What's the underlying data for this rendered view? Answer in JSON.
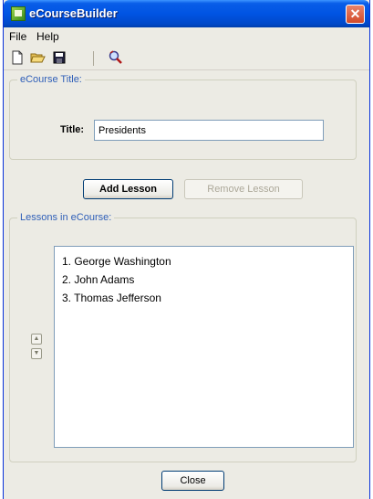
{
  "window": {
    "title": "eCourseBuilder",
    "close_glyph": "✕"
  },
  "menu": {
    "items": [
      "File",
      "Help"
    ]
  },
  "toolbar": {
    "icons": [
      "new-document-icon",
      "open-folder-icon",
      "save-disk-icon",
      "preview-magnifier-icon"
    ]
  },
  "title_section": {
    "legend": "eCourse Title:",
    "label": "Title:",
    "value": "Presidents"
  },
  "actions": {
    "add_label": "Add Lesson",
    "remove_label": "Remove Lesson"
  },
  "lessons_section": {
    "legend": "Lessons in eCourse:",
    "items": [
      "1. George Washington",
      "2. John Adams",
      "3. Thomas Jefferson"
    ],
    "move_up_glyph": "▲",
    "move_down_glyph": "▼"
  },
  "footer": {
    "close_label": "Close"
  }
}
